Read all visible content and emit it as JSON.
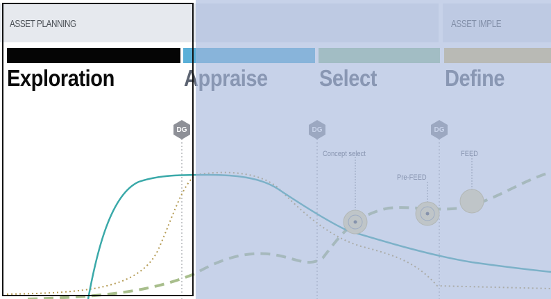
{
  "header": {
    "left_label": "ASSET PLANNING",
    "right_label": "ASSET IMPLE"
  },
  "phases": [
    {
      "label": "Exploration",
      "bar_color": "#050505",
      "label_color": "#0a0a0a"
    },
    {
      "label": "Appraise",
      "bar_color": "#5bb0d8",
      "label_color": "#5d6472"
    },
    {
      "label": "Select",
      "bar_color": "#9fc79d",
      "label_color": "#5d6472"
    },
    {
      "label": "Define",
      "bar_color": "#d9c178",
      "label_color": "#5d6472"
    }
  ],
  "gates": [
    {
      "label": "DG"
    },
    {
      "label": "DG"
    },
    {
      "label": "DG"
    }
  ],
  "annotations": {
    "concept_select": "Concept select",
    "pre_feed": "Pre-FEED",
    "feed": "FEED"
  },
  "colors": {
    "teal_curve": "#3aa9a9",
    "dotted_curve": "#b49a52",
    "dashed_curve": "#a8be8c",
    "overlay": "#a5b6dc",
    "highlight_border": "#111111"
  }
}
